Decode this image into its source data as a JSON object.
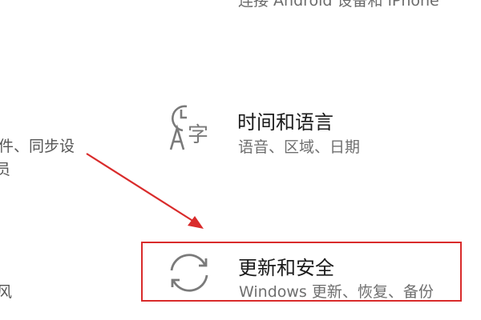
{
  "top_partial_text": "连接 Android 设备和 iPhone",
  "left_fragments": [
    "件、同步设",
    "员",
    "风"
  ],
  "tiles": {
    "time_language": {
      "title": "时间和语言",
      "desc": "语音、区域、日期",
      "icon": "time-language-icon"
    },
    "update_security": {
      "title": "更新和安全",
      "desc": "Windows 更新、恢复、备份",
      "icon": "sync-icon"
    }
  },
  "highlight_color": "#d92b2b"
}
